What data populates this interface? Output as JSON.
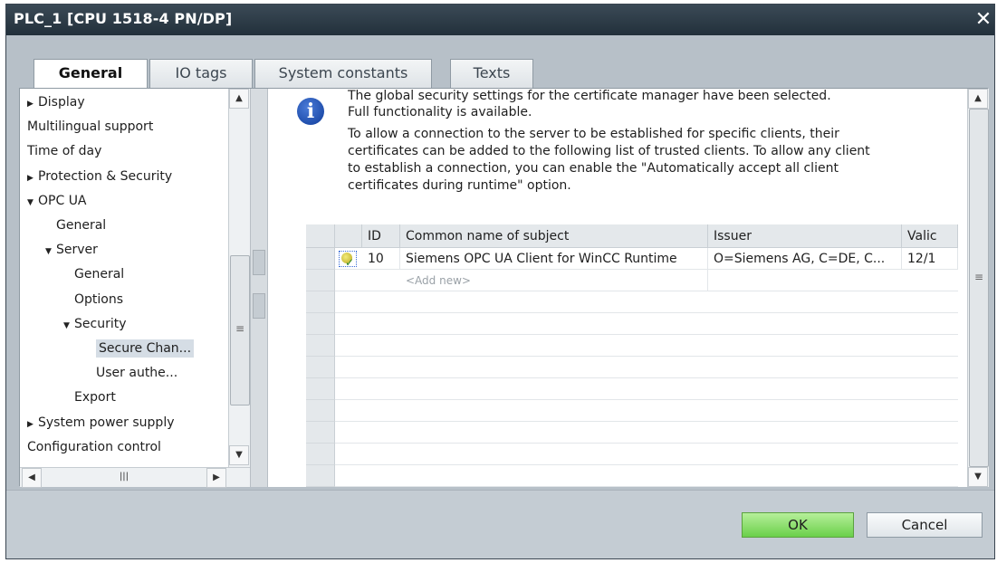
{
  "window": {
    "title": "PLC_1 [CPU 1518-4 PN/DP]",
    "close_glyph": "✕"
  },
  "tabs": [
    {
      "label": "General"
    },
    {
      "label": "IO tags"
    },
    {
      "label": "System constants"
    },
    {
      "label": "Texts"
    }
  ],
  "tree": {
    "items": [
      {
        "label": "Display",
        "arrow": "▶"
      },
      {
        "label": "Multilingual support",
        "arrow": ""
      },
      {
        "label": "Time of day",
        "arrow": ""
      },
      {
        "label": "Protection & Security",
        "arrow": "▶"
      },
      {
        "label": "OPC UA",
        "arrow": "▼"
      },
      {
        "label": "General",
        "arrow": ""
      },
      {
        "label": "Server",
        "arrow": "▼"
      },
      {
        "label": "General",
        "arrow": ""
      },
      {
        "label": "Options",
        "arrow": ""
      },
      {
        "label": "Security",
        "arrow": "▼"
      },
      {
        "label": "Secure Chan...",
        "arrow": ""
      },
      {
        "label": "User authe...",
        "arrow": ""
      },
      {
        "label": "Export",
        "arrow": ""
      },
      {
        "label": "System power supply",
        "arrow": "▶"
      },
      {
        "label": "Configuration control",
        "arrow": ""
      }
    ],
    "selected_index": 10
  },
  "info": {
    "lines": [
      "The global security settings for the certificate manager have been selected.",
      "Full functionality is available.",
      "To allow a connection to the server to be established for specific clients, their",
      "certificates can be added to the following list of trusted clients. To allow any client",
      "to establish a connection, you can enable the \"Automatically accept all client",
      "certificates during runtime\" option."
    ]
  },
  "grid": {
    "columns": [
      "ID",
      "Common name of subject",
      "Issuer",
      "Valic"
    ],
    "rows": [
      {
        "id": "10",
        "subject": "Siemens OPC UA Client for WinCC Runtime",
        "issuer": "O=Siemens AG, C=DE, C...",
        "valid": "12/1"
      }
    ],
    "add_new": "<Add new>"
  },
  "buttons": {
    "ok": "OK",
    "cancel": "Cancel"
  },
  "icons": {
    "scroll_up": "▲",
    "scroll_down": "▼",
    "scroll_left": "◀",
    "scroll_right": "▶",
    "grip": "≡",
    "hgrip": "|||",
    "info": "i"
  },
  "colors": {
    "ok_button": "#6ad04a",
    "titlebar": "#22303b",
    "info_icon": "#0f3c9a"
  }
}
